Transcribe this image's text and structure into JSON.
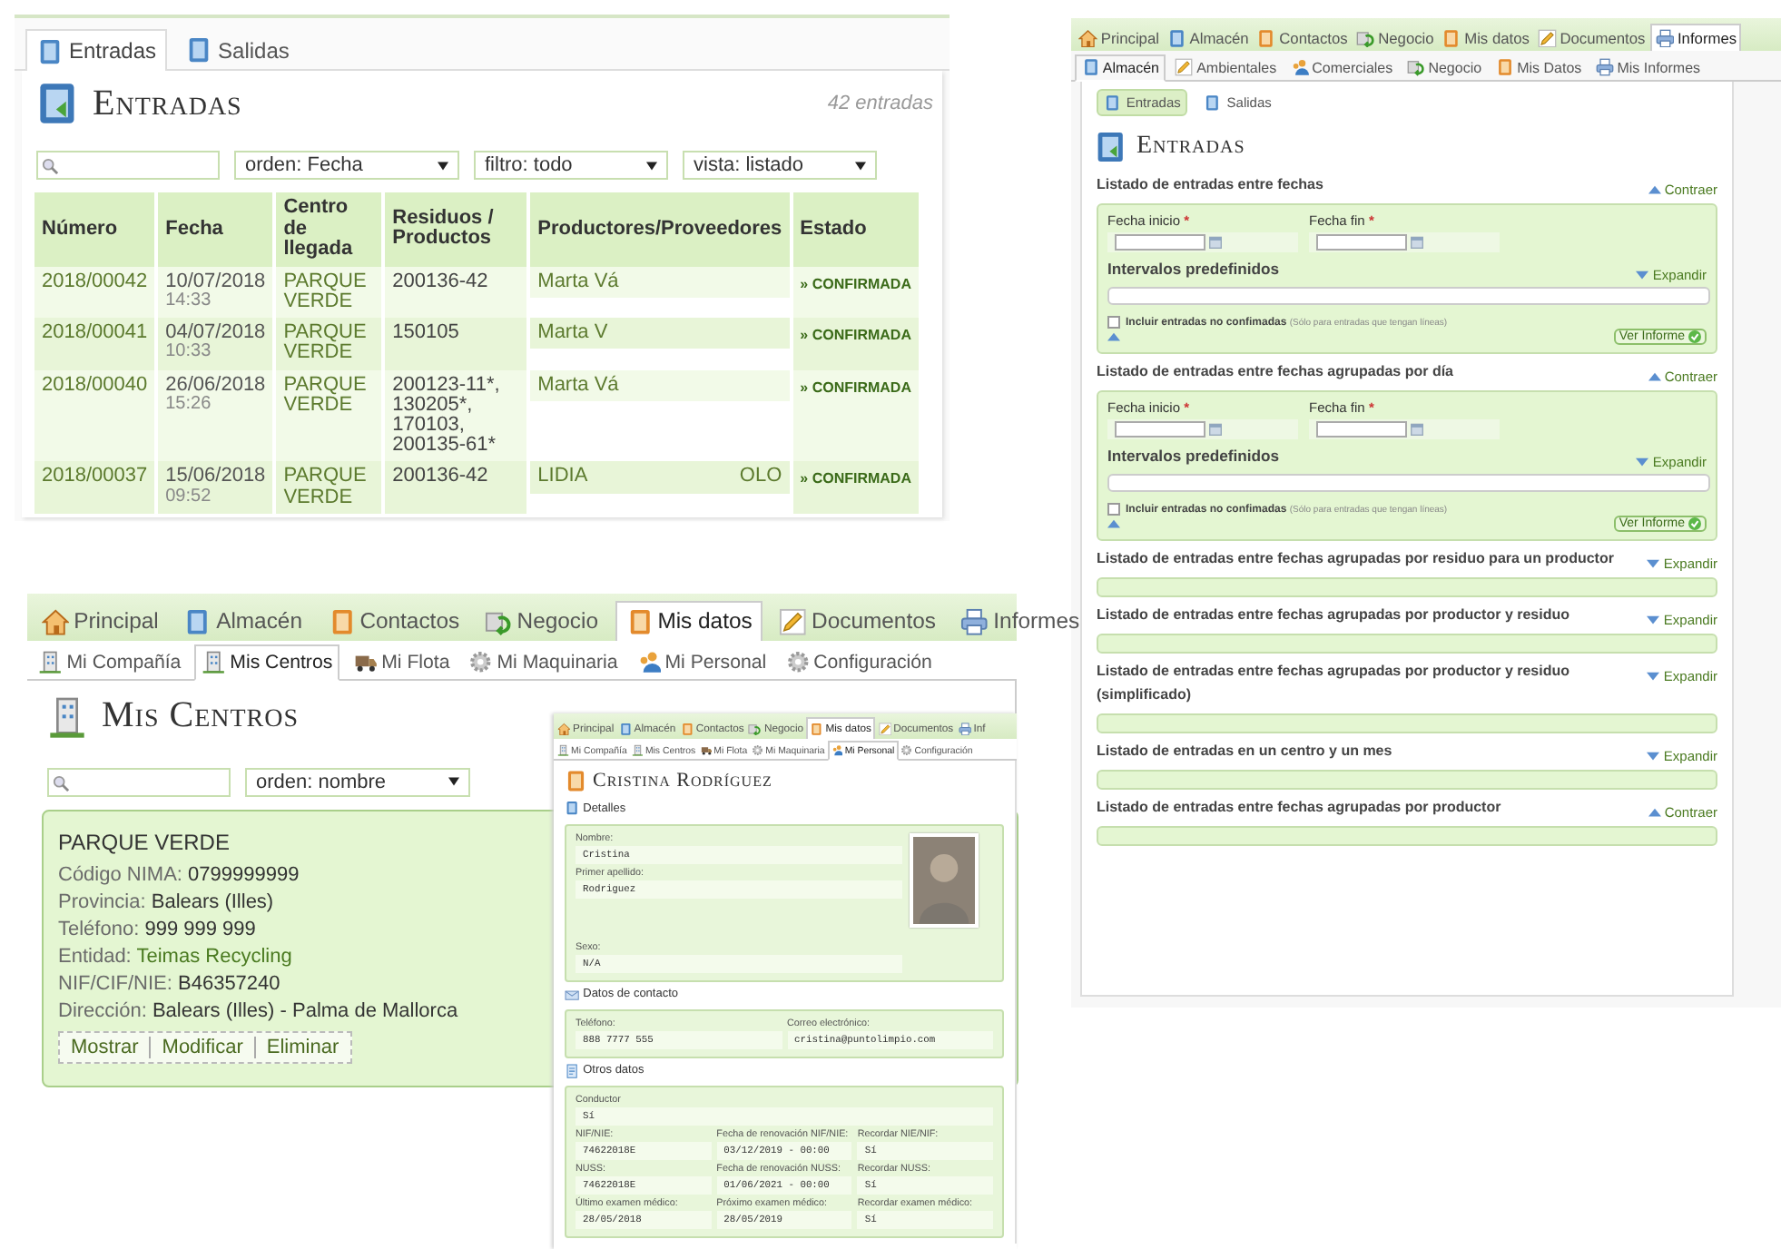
{
  "entradas_panel": {
    "tabs": [
      {
        "label": "Entradas",
        "selected": true
      },
      {
        "label": "Salidas",
        "selected": false
      }
    ],
    "title": "Entradas",
    "count": "42 entradas",
    "filters": [
      "orden: Fecha",
      "filtro: todo",
      "vista: listado"
    ],
    "table": {
      "columns": [
        "Número",
        "Fecha",
        "Centro de llegada",
        "Residuos / Productos",
        "Productores/Proveedores",
        "Estado"
      ],
      "rows": [
        {
          "numero": "2018/00042",
          "fecha": "10/07/2018",
          "hora": "14:33",
          "centro": "PARQUE VERDE",
          "residuos": "200136-42",
          "productor": [
            "Marta Vá"
          ],
          "estado": "» CONFIRMADA"
        },
        {
          "numero": "2018/00041",
          "fecha": "04/07/2018",
          "hora": "10:33",
          "centro": "PARQUE VERDE",
          "residuos": "150105",
          "productor": [
            "Marta V"
          ],
          "estado": "» CONFIRMADA"
        },
        {
          "numero": "2018/00040",
          "fecha": "26/06/2018",
          "hora": "15:26",
          "centro": "PARQUE VERDE",
          "residuos": "200123-11*, 130205*, 170103, 200135-61*",
          "productor": [
            "Marta Vá"
          ],
          "estado": "» CONFIRMADA"
        },
        {
          "numero": "2018/00037",
          "fecha": "15/06/2018",
          "hora": "09:52",
          "centro": "PARQUE VERDE",
          "residuos": "200136-42",
          "productor": [
            "LIDIA",
            "OLO"
          ],
          "estado": "» CONFIRMADA"
        }
      ]
    }
  },
  "informes_panel": {
    "nav": [
      {
        "label": "Principal",
        "selected": false
      },
      {
        "label": "Almacén",
        "selected": false
      },
      {
        "label": "Contactos",
        "selected": false
      },
      {
        "label": "Negocio",
        "selected": false
      },
      {
        "label": "Mis datos",
        "selected": false
      },
      {
        "label": "Documentos",
        "selected": false
      },
      {
        "label": "Informes",
        "selected": true
      }
    ],
    "subnav": [
      {
        "label": "Almacén",
        "selected": true
      },
      {
        "label": "Ambientales",
        "selected": false
      },
      {
        "label": "Comerciales",
        "selected": false
      },
      {
        "label": "Negocio",
        "selected": false
      },
      {
        "label": "Mis Datos",
        "selected": false
      },
      {
        "label": "Mis Informes",
        "selected": false
      }
    ],
    "section_tabs": [
      {
        "label": "Entradas",
        "selected": true
      },
      {
        "label": "Salidas",
        "selected": false
      }
    ],
    "title": "Entradas",
    "reports": [
      {
        "kind": "form",
        "title": "Listado de entradas entre fechas",
        "toggle": "Contraer",
        "expanded": true,
        "fields": [
          {
            "label": "Fecha inicio",
            "mark": "*"
          },
          {
            "label": "Fecha fin",
            "mark": "*"
          }
        ],
        "intervals": {
          "label": "Intervalos predefinidos",
          "toggle": "Expandir"
        },
        "checkbox": {
          "label": "Incluir entradas no confimadas",
          "note": "(Sólo para entradas que tengan líneas)",
          "checked": false
        },
        "button": "Ver Informe"
      },
      {
        "kind": "form",
        "title": "Listado de entradas entre fechas agrupadas por día",
        "toggle": "Contraer",
        "expanded": true,
        "fields": [
          {
            "label": "Fecha inicio",
            "mark": "*"
          },
          {
            "label": "Fecha fin",
            "mark": "*"
          }
        ],
        "intervals": {
          "label": "Intervalos predefinidos",
          "toggle": "Expandir"
        },
        "checkbox": {
          "label": "Incluir entradas no confimadas",
          "note": "(Sólo para entradas que tengan líneas)",
          "checked": false
        },
        "button": "Ver Informe"
      },
      {
        "kind": "bar",
        "title": "Listado de entradas entre fechas agrupadas por residuo para un productor",
        "toggle": "Expandir",
        "expanded": false
      },
      {
        "kind": "bar",
        "title": "Listado de entradas entre fechas agrupadas por productor y residuo",
        "toggle": "Expandir",
        "expanded": false
      },
      {
        "kind": "bar",
        "title": "Listado de entradas entre fechas agrupadas por productor y residuo (simplificado)",
        "toggle": "Expandir",
        "expanded": false
      },
      {
        "kind": "bar",
        "title": "Listado de entradas en un centro y un mes",
        "toggle": "Expandir",
        "expanded": false
      },
      {
        "kind": "bar",
        "title": "Listado de entradas entre fechas agrupadas por productor",
        "toggle": "Contraer",
        "expanded": true
      }
    ]
  },
  "centros_panel": {
    "nav": [
      {
        "label": "Principal",
        "selected": false
      },
      {
        "label": "Almacén",
        "selected": false
      },
      {
        "label": "Contactos",
        "selected": false
      },
      {
        "label": "Negocio",
        "selected": false
      },
      {
        "label": "Mis datos",
        "selected": true
      },
      {
        "label": "Documentos",
        "selected": false
      },
      {
        "label": "Informes",
        "selected": false
      }
    ],
    "subnav": [
      {
        "label": "Mi Compañía",
        "selected": false
      },
      {
        "label": "Mis Centros",
        "selected": true
      },
      {
        "label": "Mi Flota",
        "selected": false
      },
      {
        "label": "Mi Maquinaria",
        "selected": false
      },
      {
        "label": "Mi Personal",
        "selected": false
      },
      {
        "label": "Configuración",
        "selected": false
      }
    ],
    "title": "Mis Centros",
    "sort": "orden: nombre",
    "center": {
      "name": "PARQUE VERDE",
      "fields": [
        {
          "label": "Código NIMA:",
          "value": "0799999999",
          "kind": "text"
        },
        {
          "label": "Provincia:",
          "value": "Balears (Illes)",
          "kind": "text"
        },
        {
          "label": "Teléfono:",
          "value": "999 999 999",
          "kind": "text"
        },
        {
          "label": "Entidad:",
          "value": "Teimas Recycling",
          "kind": "link"
        },
        {
          "label": "NIF/CIF/NIE:",
          "value": "B46357240",
          "kind": "text"
        },
        {
          "label": "Dirección:",
          "value": "Balears (Illes) - Palma de Mallorca",
          "kind": "text"
        }
      ],
      "actions": [
        "Mostrar",
        "Modificar",
        "Eliminar"
      ]
    }
  },
  "personal_panel": {
    "nav": [
      {
        "label": "Principal",
        "selected": false
      },
      {
        "label": "Almacén",
        "selected": false
      },
      {
        "label": "Contactos",
        "selected": false
      },
      {
        "label": "Negocio",
        "selected": false
      },
      {
        "label": "Mis datos",
        "selected": true
      },
      {
        "label": "Documentos",
        "selected": false
      },
      {
        "label": "Inf",
        "selected": false
      }
    ],
    "subnav": [
      {
        "label": "Mi Compañía",
        "selected": false
      },
      {
        "label": "Mis Centros",
        "selected": false
      },
      {
        "label": "Mi Flota",
        "selected": false
      },
      {
        "label": "Mi Maquinaria",
        "selected": false
      },
      {
        "label": "Mi Personal",
        "selected": true
      },
      {
        "label": "Configuración",
        "selected": false
      }
    ],
    "title": "Cristina Rodríguez",
    "sections": [
      {
        "kind": "photo",
        "title": "Detalles",
        "rows": [
          [
            {
              "label": "Nombre:",
              "value": "Cristina"
            }
          ],
          [
            {
              "label": "Primer apellido:",
              "value": "Rodriguez"
            }
          ],
          [
            {
              "label": "Sexo:",
              "value": "N/A"
            }
          ]
        ]
      },
      {
        "kind": "plain",
        "title": "Datos de contacto",
        "rows": [
          [
            {
              "label": "Teléfono:",
              "value": "888 7777 555"
            },
            {
              "label": "Correo electrónico:",
              "value": "cristina@puntolimpio.com"
            }
          ]
        ]
      },
      {
        "kind": "plain",
        "title": "Otros datos",
        "rows": [
          [
            {
              "label": "Conductor",
              "value": "Sí"
            }
          ],
          [
            {
              "label": "NIF/NIE:",
              "value": "74622018E"
            },
            {
              "label": "Fecha de renovación NIF/NIE:",
              "value": "03/12/2019 - 00:00"
            },
            {
              "label": "Recordar NIE/NIF:",
              "value": "Sí"
            }
          ],
          [
            {
              "label": "NUSS:",
              "value": "74622018E"
            },
            {
              "label": "Fecha de renovación NUSS:",
              "value": "01/06/2021 - 00:00"
            },
            {
              "label": "Recordar NUSS:",
              "value": "Sí"
            }
          ],
          [
            {
              "label": "Último examen médico:",
              "value": "28/05/2018"
            },
            {
              "label": "Próximo examen médico:",
              "value": "28/05/2019"
            },
            {
              "label": "Recordar examen médico:",
              "value": "Sí"
            }
          ]
        ]
      }
    ]
  }
}
